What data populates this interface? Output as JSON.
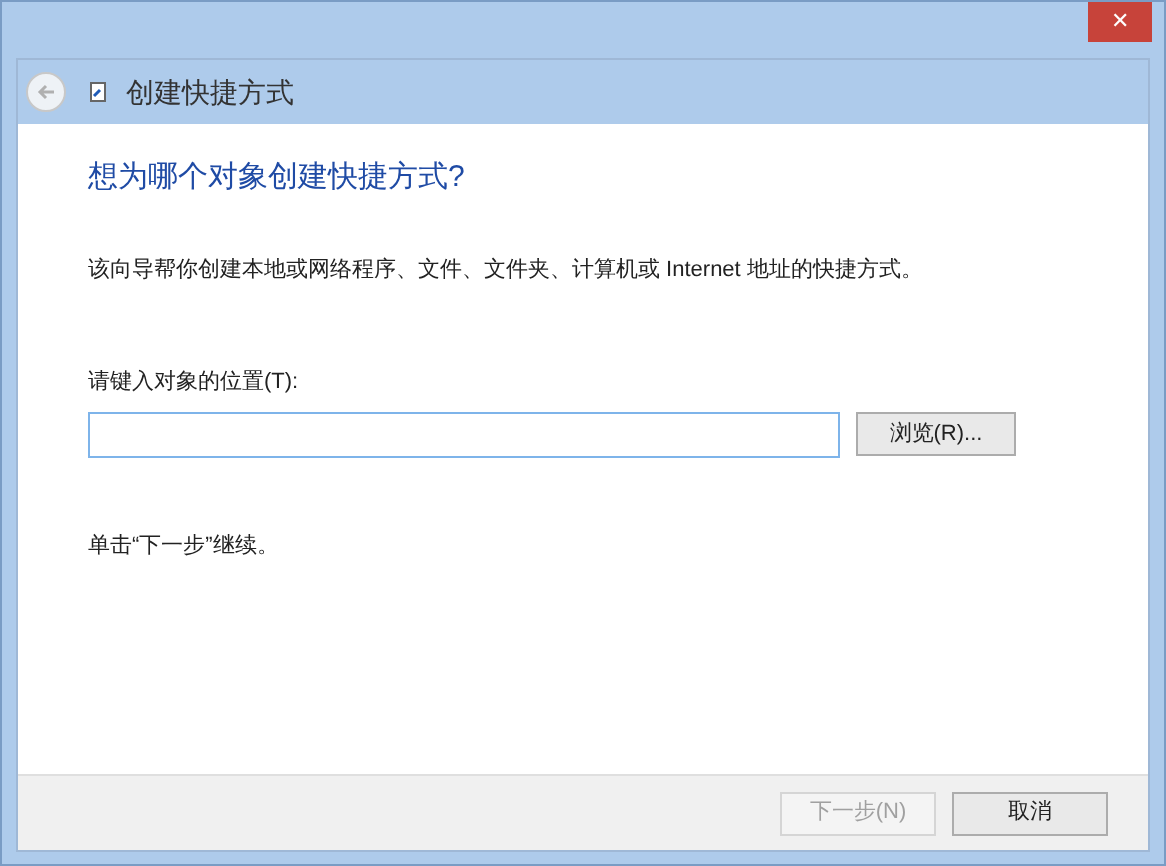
{
  "window": {
    "close": "✕",
    "title": "创建快捷方式"
  },
  "heading": "想为哪个对象创建快捷方式?",
  "description": "该向导帮你创建本地或网络程序、文件、文件夹、计算机或 Internet 地址的快捷方式。",
  "location": {
    "label": "请键入对象的位置(T):",
    "browse": "浏览(R)..."
  },
  "hint": "单击“下一步”继续。",
  "buttons": [
    {
      "label": "下一步(N)",
      "disabled": true
    },
    {
      "label": "取消",
      "disabled": false
    }
  ]
}
